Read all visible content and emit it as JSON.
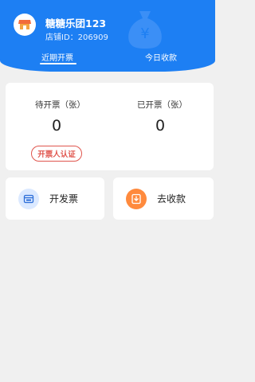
{
  "shop": {
    "name": "糖糖乐团123",
    "id_text": "店铺ID：206909"
  },
  "tabs": {
    "recent_invoice": "近期开票",
    "today_collection": "今日收款",
    "active": "近期开票"
  },
  "stats": {
    "pending_label": "待开票（张）",
    "pending_value": "0",
    "issued_label": "已开票（张）",
    "issued_value": "0",
    "auth_button": "开票人认证"
  },
  "actions": {
    "issue_invoice": "开发票",
    "collect_payment": "去收款"
  },
  "colors": {
    "header_blue": "#1d7ff3",
    "accent_red": "#e0554d",
    "accent_orange": "#ff8a3d"
  },
  "icons": {
    "avatar": "shop-icon",
    "decoration": "money-bag-icon",
    "invoice": "invoice-printer-icon",
    "collect": "download-icon"
  }
}
